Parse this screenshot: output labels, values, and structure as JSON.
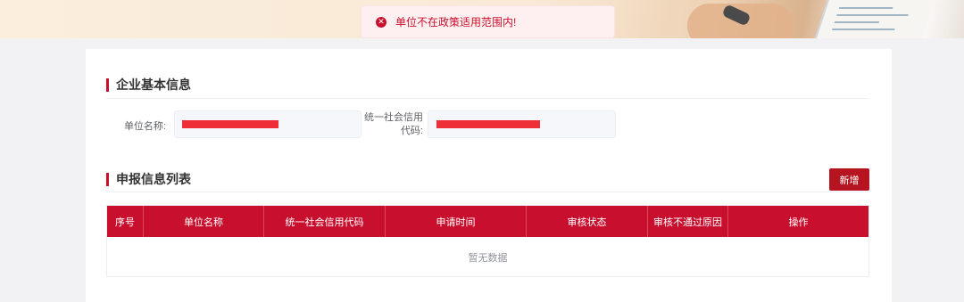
{
  "toast": {
    "message": "单位不在政策适用范围内!",
    "icon": "error-circle-icon",
    "color": "#c8102e"
  },
  "basic_info": {
    "title": "企业基本信息",
    "unit_name_label": "单位名称:",
    "unit_name_value": "",
    "credit_code_label_line1": "统一社会信用",
    "credit_code_label_line2": "代码:",
    "credit_code_value": ""
  },
  "declaration": {
    "title": "申报信息列表",
    "add_button": "新增",
    "columns": [
      "序号",
      "单位名称",
      "统一社会信用代码",
      "申请时间",
      "审核状态",
      "审核不通过原因",
      "操作"
    ],
    "rows": [],
    "empty_text": "暂无数据"
  },
  "colors": {
    "accent": "#c8102e",
    "button": "#b71422",
    "redaction": "#ee2f38"
  }
}
